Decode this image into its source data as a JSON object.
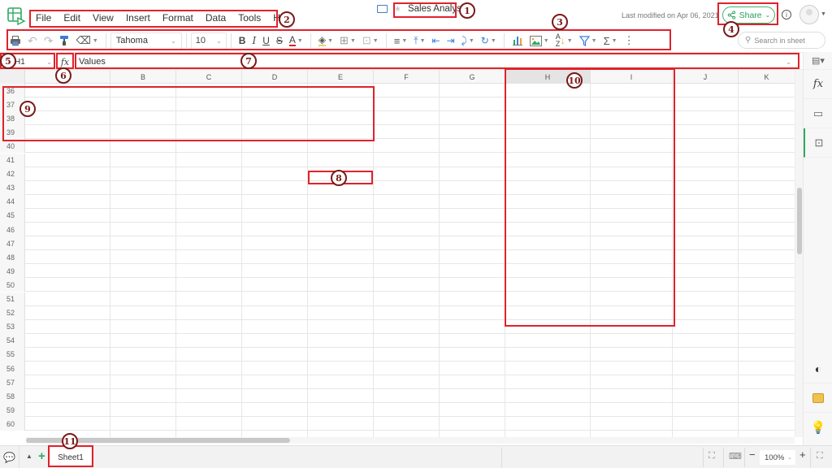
{
  "app": {
    "document_title": "Sales Analysis",
    "last_modified": "Last modified on Apr 06, 2021",
    "share_label": "Share"
  },
  "menu": [
    "File",
    "Edit",
    "View",
    "Insert",
    "Format",
    "Data",
    "Tools",
    "Help"
  ],
  "toolbar": {
    "font_family": "Tahoma",
    "font_size": "10",
    "icons": [
      "print-icon",
      "undo-icon",
      "redo-icon",
      "format-painter-icon",
      "clear-format-icon",
      "bold-icon",
      "italic-icon",
      "underline-icon",
      "strikethrough-icon",
      "text-color-icon",
      "fill-color-icon",
      "borders-icon",
      "merge-cells-icon",
      "horizontal-align-icon",
      "vertical-align-icon",
      "decrease-indent-icon",
      "increase-indent-icon",
      "wrap-text-icon",
      "rotate-text-icon",
      "chart-icon",
      "image-icon",
      "sort-icon",
      "filter-icon",
      "sum-icon",
      "more-icon"
    ],
    "bold": "B",
    "italic": "I",
    "underline": "U",
    "strike": "S",
    "textcolor": "A",
    "sum": "Σ",
    "more": "⋮"
  },
  "search": {
    "placeholder": "Search in sheet"
  },
  "formula_bar": {
    "cell_ref": "H1",
    "fx_label": "fx",
    "value": "Values"
  },
  "grid": {
    "columns": [
      "A",
      "B",
      "C",
      "D",
      "E",
      "F",
      "G",
      "H",
      "I",
      "J",
      "K"
    ],
    "selected_column": "H",
    "rows": [
      "36",
      "37",
      "38",
      "39",
      "40",
      "41",
      "42",
      "43",
      "44",
      "45",
      "46",
      "47",
      "48",
      "49",
      "50",
      "51",
      "52",
      "53",
      "54",
      "55",
      "56",
      "57",
      "58",
      "59",
      "60"
    ]
  },
  "right_sidebar": {
    "items": [
      "cell-format-icon",
      "function-icon",
      "comment-icon",
      "sheet-panel-icon",
      "theme-icon",
      "feedback-icon",
      "ideas-icon"
    ],
    "fx_label": "fx"
  },
  "bottom": {
    "sheets": [
      "Sheet1"
    ],
    "zoom": "100%",
    "zoom_minus": "−",
    "zoom_plus": "+"
  },
  "annotations": [
    "1",
    "2",
    "3",
    "4",
    "5",
    "6",
    "7",
    "8",
    "9",
    "10",
    "11"
  ],
  "colors": {
    "accent_green": "#2daa5e",
    "annotation_red": "#e0222b",
    "annotation_circle": "#7a1a1a"
  }
}
